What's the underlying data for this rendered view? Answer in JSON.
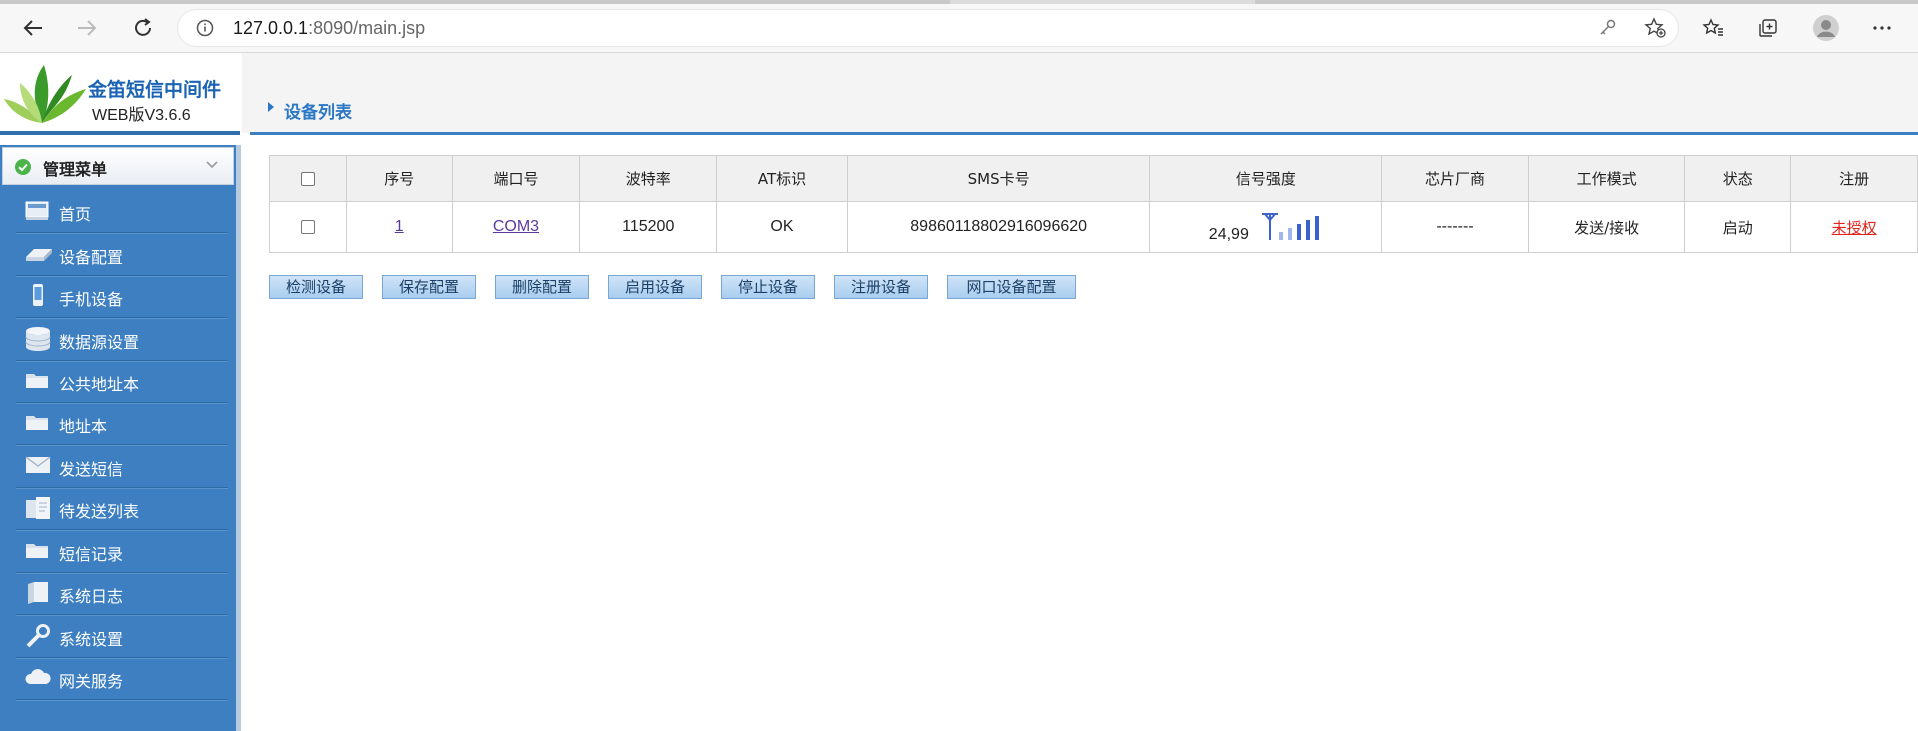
{
  "browser": {
    "url_host": "127.0.0.1",
    "url_rest": ":8090/main.jsp"
  },
  "logo": {
    "title": "金笛短信中间件",
    "subtitle": "WEB版V3.6.6"
  },
  "menu": {
    "header": "管理菜单",
    "items": [
      {
        "label": "首页",
        "icon": "home-icon"
      },
      {
        "label": "设备配置",
        "icon": "device-config-icon"
      },
      {
        "label": "手机设备",
        "icon": "phone-icon"
      },
      {
        "label": "数据源设置",
        "icon": "database-icon"
      },
      {
        "label": "公共地址本",
        "icon": "folder-icon"
      },
      {
        "label": "地址本",
        "icon": "folder-icon"
      },
      {
        "label": "发送短信",
        "icon": "envelope-icon"
      },
      {
        "label": "待发送列表",
        "icon": "clipboard-icon"
      },
      {
        "label": "短信记录",
        "icon": "folder-icon"
      },
      {
        "label": "系统日志",
        "icon": "book-icon"
      },
      {
        "label": "系统设置",
        "icon": "wrench-icon"
      },
      {
        "label": "网关服务",
        "icon": "cloud-icon"
      }
    ]
  },
  "page": {
    "title": "设备列表"
  },
  "table": {
    "headers": [
      "序号",
      "端口号",
      "波特率",
      "AT标识",
      "SMS卡号",
      "信号强度",
      "芯片厂商",
      "工作模式",
      "状态",
      "注册"
    ],
    "rows": [
      {
        "index": "1",
        "port": "COM3",
        "baud": "115200",
        "at": "OK",
        "sms_card": "89860118802916096620",
        "signal": "24,99",
        "signal_level": 5,
        "vendor": "-------",
        "mode": "发送/接收",
        "status": "启动",
        "register": "未授权"
      }
    ]
  },
  "buttons": [
    "检测设备",
    "保存配置",
    "删除配置",
    "启用设备",
    "停止设备",
    "注册设备",
    "网口设备配置"
  ],
  "colors": {
    "accent": "#2b78c5",
    "sidebar": "#3d7fc0",
    "unauthorized": "#e2231a"
  }
}
